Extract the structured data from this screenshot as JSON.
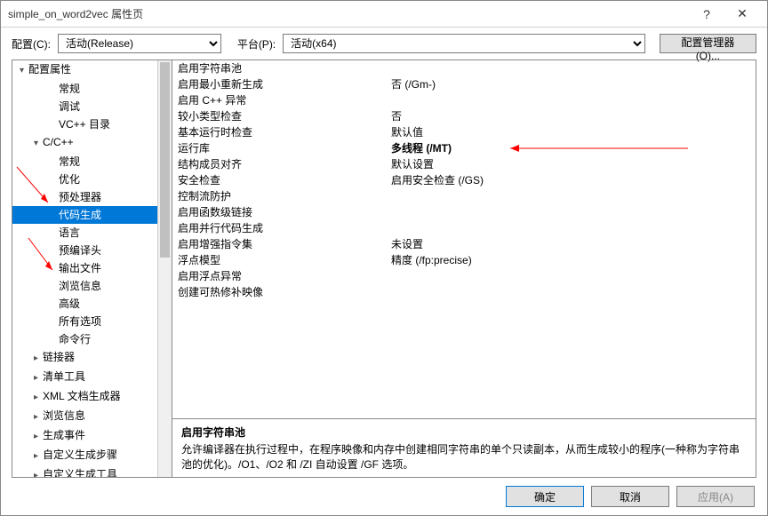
{
  "window": {
    "title": "simple_on_word2vec 属性页",
    "help": "?",
    "close": "✕"
  },
  "toolbar": {
    "config_label": "配置(C):",
    "config_value": "活动(Release)",
    "platform_label": "平台(P):",
    "platform_value": "活动(x64)",
    "manager": "配置管理器(O)..."
  },
  "tree": [
    {
      "label": "配置属性",
      "depth": 0,
      "exp": "▾"
    },
    {
      "label": "常规",
      "depth": 2
    },
    {
      "label": "调试",
      "depth": 2
    },
    {
      "label": "VC++ 目录",
      "depth": 2
    },
    {
      "label": "C/C++",
      "depth": 1,
      "exp": "▾"
    },
    {
      "label": "常规",
      "depth": 2
    },
    {
      "label": "优化",
      "depth": 2
    },
    {
      "label": "预处理器",
      "depth": 2
    },
    {
      "label": "代码生成",
      "depth": 2,
      "selected": true
    },
    {
      "label": "语言",
      "depth": 2
    },
    {
      "label": "预编译头",
      "depth": 2
    },
    {
      "label": "输出文件",
      "depth": 2
    },
    {
      "label": "浏览信息",
      "depth": 2
    },
    {
      "label": "高级",
      "depth": 2
    },
    {
      "label": "所有选项",
      "depth": 2
    },
    {
      "label": "命令行",
      "depth": 2
    },
    {
      "label": "链接器",
      "depth": 1,
      "exp": "▸"
    },
    {
      "label": "清单工具",
      "depth": 1,
      "exp": "▸"
    },
    {
      "label": "XML 文档生成器",
      "depth": 1,
      "exp": "▸"
    },
    {
      "label": "浏览信息",
      "depth": 1,
      "exp": "▸"
    },
    {
      "label": "生成事件",
      "depth": 1,
      "exp": "▸"
    },
    {
      "label": "自定义生成步骤",
      "depth": 1,
      "exp": "▸"
    },
    {
      "label": "自定义生成工具",
      "depth": 1,
      "exp": "▸"
    }
  ],
  "grid": [
    {
      "label": "启用字符串池",
      "value": ""
    },
    {
      "label": "启用最小重新生成",
      "value": "否 (/Gm-)"
    },
    {
      "label": "启用 C++ 异常",
      "value": ""
    },
    {
      "label": "较小类型检查",
      "value": "否"
    },
    {
      "label": "基本运行时检查",
      "value": "默认值"
    },
    {
      "label": "运行库",
      "value": "多线程 (/MT)",
      "bold": true
    },
    {
      "label": "结构成员对齐",
      "value": "默认设置"
    },
    {
      "label": "安全检查",
      "value": "启用安全检查 (/GS)"
    },
    {
      "label": "控制流防护",
      "value": ""
    },
    {
      "label": "启用函数级链接",
      "value": ""
    },
    {
      "label": "启用并行代码生成",
      "value": ""
    },
    {
      "label": "启用增强指令集",
      "value": "未设置"
    },
    {
      "label": "浮点模型",
      "value": "精度 (/fp:precise)"
    },
    {
      "label": "启用浮点异常",
      "value": ""
    },
    {
      "label": "创建可热修补映像",
      "value": ""
    }
  ],
  "description": {
    "title": "启用字符串池",
    "body": "允许编译器在执行过程中，在程序映像和内存中创建相同字符串的单个只读副本，从而生成较小的程序(一种称为字符串池的优化)。/O1、/O2 和 /ZI 自动设置 /GF 选项。"
  },
  "footer": {
    "ok": "确定",
    "cancel": "取消",
    "apply": "应用(A)"
  }
}
